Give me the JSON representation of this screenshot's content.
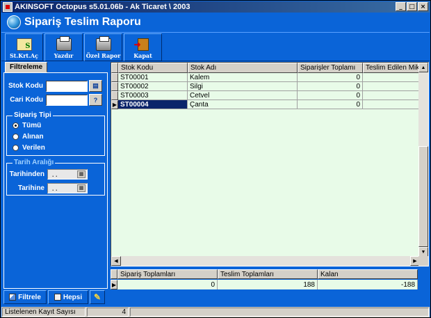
{
  "window": {
    "title": "AKINSOFT Octopus s5.01.06b  -  Ak Ticaret \\ 2003",
    "controls": {
      "minimize": "_",
      "maximize": "□",
      "close": "×"
    }
  },
  "header": {
    "title": "Sipariş Teslim Raporu",
    "icon": "globe-icon"
  },
  "toolbar": {
    "items": [
      {
        "label": "St.Krt.Aç",
        "icon": "stock-card-icon"
      },
      {
        "label": "Yazdır",
        "icon": "printer-icon"
      },
      {
        "label": "Özel Rapor",
        "icon": "printer-custom-icon"
      },
      {
        "label": "Kapat",
        "icon": "exit-door-icon"
      }
    ]
  },
  "filter_panel": {
    "tab": "Filtreleme",
    "stok_kodu": {
      "label": "Stok Kodu",
      "value": ""
    },
    "cari_kodu": {
      "label": "Cari Kodu",
      "value": ""
    },
    "siparis_tipi": {
      "title": "Sipariş Tipi",
      "options": [
        {
          "label": "Tümü",
          "selected": true
        },
        {
          "label": "Alınan",
          "selected": false
        },
        {
          "label": "Verilen",
          "selected": false
        }
      ]
    },
    "tarih_araligi": {
      "title": "Tarih Aralığı",
      "from_label": "Tarihinden",
      "to_label": "Tarihine",
      "from_value": ". .",
      "to_value": ". ."
    },
    "buttons": {
      "filter": "Filtrele",
      "all": "Hepsi"
    }
  },
  "grid": {
    "columns": [
      "Stok Kodu",
      "Stok Adı",
      "Siparişler Toplamı",
      "Teslim Edilen Mik"
    ],
    "rows": [
      {
        "code": "ST00001",
        "name": "Kalem",
        "total": "0"
      },
      {
        "code": "ST00002",
        "name": "Silgi",
        "total": "0"
      },
      {
        "code": "ST00003",
        "name": "Cetvel",
        "total": "0"
      },
      {
        "code": "ST00004",
        "name": "Çanta",
        "total": "0"
      }
    ],
    "selected_row": 3
  },
  "totals": {
    "columns": [
      "Sipariş Toplamları",
      "Teslim Toplamları",
      "Kalan"
    ],
    "values": [
      "0",
      "188",
      "-188"
    ]
  },
  "status": {
    "label": "Listelenen Kayıt Sayısı",
    "count": "4"
  }
}
